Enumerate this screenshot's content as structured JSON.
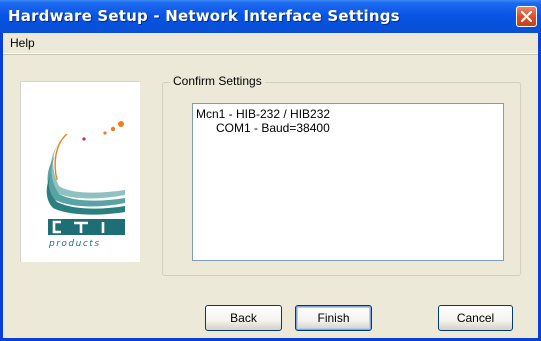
{
  "window": {
    "title": "Hardware Setup - Network Interface Settings",
    "close_icon": "close-icon"
  },
  "menu": {
    "help": "Help"
  },
  "logo": {
    "brand": "CTI",
    "tagline": "products"
  },
  "confirm": {
    "group_label": "Confirm Settings",
    "lines": [
      "Mcn1 - HIB-232 / HIB232",
      "COM1 - Baud=38400"
    ]
  },
  "buttons": {
    "back": "Back",
    "finish": "Finish",
    "cancel": "Cancel"
  },
  "colors": {
    "titlebar": "#0a55e6",
    "close": "#d9512c",
    "logo_teal": "#2a7f7f",
    "logo_orange": "#f07d1a"
  }
}
